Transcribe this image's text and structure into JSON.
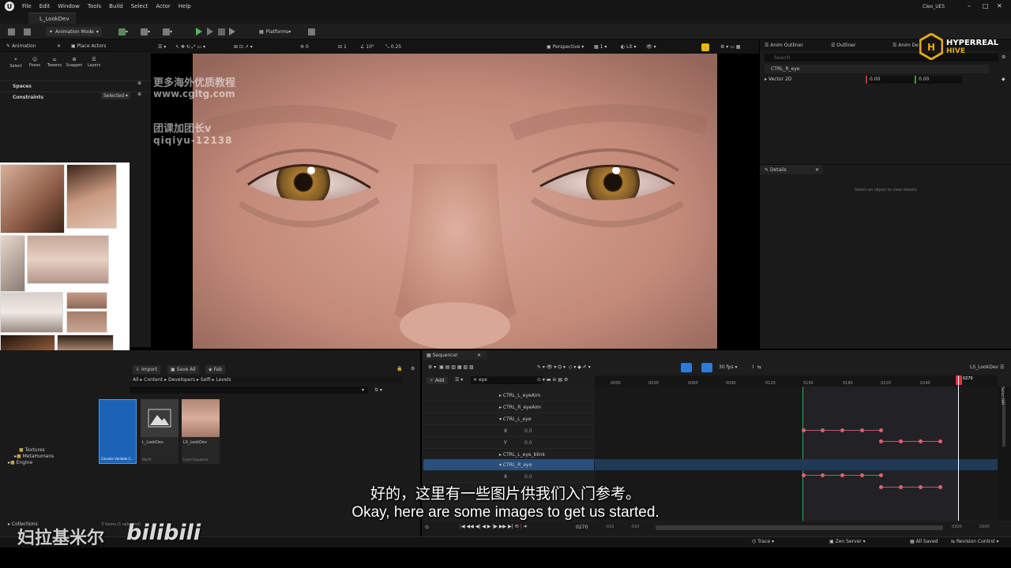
{
  "menu": {
    "file": "File",
    "edit": "Edit",
    "window": "Window",
    "tools": "Tools",
    "build": "Build",
    "select": "Select",
    "actor": "Actor",
    "help": "Help",
    "project": "Cleo_UE5"
  },
  "level_tab": "L_LookDev",
  "toolbar": {
    "mode": "Animation Mode",
    "platforms": "Platforms"
  },
  "viewport_bar": {
    "perspective": "Perspective",
    "lit": "Lit",
    "v1": "0",
    "v2": "1",
    "angle": "10°",
    "scale": "0.25",
    "views": "1"
  },
  "left_panel": {
    "tab_animation": "Animation",
    "tab_place": "Place Actors",
    "tools": [
      "Select",
      "Poses",
      "Tweens",
      "Snapper",
      "Layers"
    ],
    "spaces": "Spaces",
    "constraints": "Constraints",
    "selected": "Selected"
  },
  "outliner": {
    "tab1": "Anim Outliner",
    "tab2": "Outliner",
    "tab3": "Anim De",
    "search": "Search",
    "item": "CTRL_R_eye",
    "prop": "Vector 2D",
    "x": "0.00",
    "y": "0.00"
  },
  "details": {
    "title": "Details",
    "empty": "Select an object to view details."
  },
  "content_browser": {
    "import": "Import",
    "save_all": "Save All",
    "fab": "Fab",
    "path": [
      "All",
      "Content",
      "Developers",
      "Selfi",
      "Levels"
    ],
    "assets": [
      {
        "name": "L_LookDev",
        "type": "World"
      },
      {
        "name": "LS_LookDev",
        "type": "Level Sequence"
      }
    ],
    "first_asset": "Console Variable C...",
    "tree": [
      "Textures",
      "MetaHumans",
      "Engine"
    ],
    "collections": "Collections",
    "count": "3 items (1 selected)"
  },
  "sequencer": {
    "title": "Sequencer",
    "add": "Add",
    "filter": "eye",
    "fps": "30 fps",
    "name": "LS_LookDev",
    "tracks": [
      "CTRL_L_eyeAim",
      "CTRL_R_eyeAim",
      "CTRL_L_eye",
      "X",
      "Y",
      "CTRL_L_eye_blink",
      "CTRL_R_eye",
      "X"
    ],
    "values": [
      "0.0",
      "0.0",
      "0.0"
    ],
    "ticks": [
      "0000",
      "0030",
      "0060",
      "0090",
      "0120",
      "0150",
      "0180",
      "0210",
      "0240"
    ],
    "playhead": "0270",
    "current": "0270",
    "start": "-015",
    "start2": "-010",
    "end": "0300",
    "end2": "0300",
    "selection": "Selection"
  },
  "status": {
    "trace": "Trace",
    "zen": "Zen Server",
    "saved": "All Saved",
    "revision": "Revision Control"
  },
  "subtitle": {
    "zh": "好的，这里有一些图片供我们入门参考。",
    "en": "Okay, here are some images to get us started."
  },
  "watermarks": {
    "l1": "更多海外优质教程",
    "l2": "www.cgltg.com",
    "l3": "团课加团长v",
    "l4": "qiqiyu-12138",
    "brand": "HYPERREAL",
    "brand2": "HIVE",
    "channel": "妇拉基米尔",
    "site": "bilibili"
  },
  "colors": {
    "accent": "#4a9ef0",
    "keys": "#e06070",
    "playhead": "#e03040"
  }
}
